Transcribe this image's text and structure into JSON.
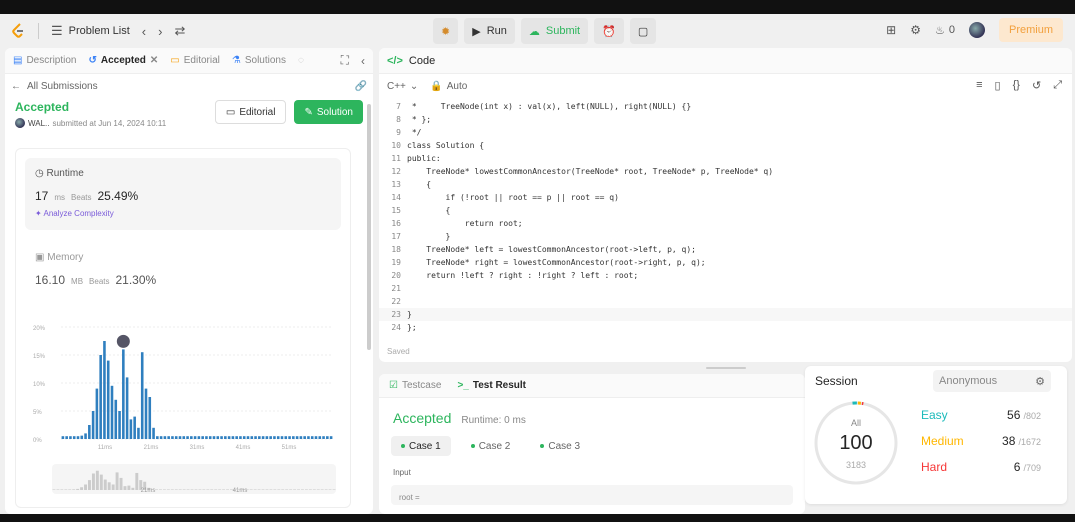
{
  "nav": {
    "problem_list": "Problem List",
    "run": "Run",
    "submit": "Submit",
    "streak": "0",
    "premium": "Premium"
  },
  "left_panel": {
    "tabs": [
      {
        "label": "Description"
      },
      {
        "label": "Accepted"
      },
      {
        "label": "Editorial"
      },
      {
        "label": "Solutions"
      }
    ],
    "back_label": "All Submissions",
    "status": "Accepted",
    "user": "WAL..",
    "submitted": "submitted at Jun 14, 2024 10:11",
    "editorial_btn": "Editorial",
    "solution_btn": "Solution",
    "runtime_label": "Runtime",
    "runtime_value": "17",
    "runtime_unit": "ms",
    "beats_label": "Beats",
    "runtime_beats": "25.49%",
    "analyze": "Analyze Complexity",
    "memory_label": "Memory",
    "memory_value": "16.10",
    "memory_unit": "MB",
    "memory_beats": "21.30%"
  },
  "chart_data": {
    "type": "bar",
    "y_ticks": [
      "20%",
      "15%",
      "10%",
      "5%",
      "0%"
    ],
    "x_ticks": [
      "11ms",
      "21ms",
      "31ms",
      "41ms",
      "51ms"
    ],
    "mini_ticks": [
      "21ms",
      "41ms"
    ],
    "ylim": [
      0,
      20
    ],
    "values": [
      0.5,
      0.5,
      0.5,
      0.5,
      0.5,
      0.6,
      1.0,
      2.5,
      5.0,
      9.0,
      15.0,
      17.5,
      14.0,
      9.5,
      7.0,
      5.0,
      16.0,
      11.0,
      3.5,
      4.0,
      2.0,
      15.5,
      9.0,
      7.5,
      2.0,
      0.5,
      0.5,
      0.5,
      0.5,
      0.5,
      0.5,
      0.5,
      0.5,
      0.5,
      0.5,
      0.5,
      0.5,
      0.5,
      0.5,
      0.5,
      0.5,
      0.5,
      0.5,
      0.5,
      0.5,
      0.5,
      0.5,
      0.5,
      0.5,
      0.5,
      0.5,
      0.5,
      0.5,
      0.5,
      0.5,
      0.5,
      0.5,
      0.5,
      0.5,
      0.5,
      0.5,
      0.5,
      0.5,
      0.5,
      0.5,
      0.5,
      0.5,
      0.5,
      0.5,
      0.5,
      0.5,
      0.5
    ],
    "highlight_index": 16,
    "color": "#2f7fbf"
  },
  "code_panel": {
    "title": "Code",
    "language": "C++",
    "mode": "Auto",
    "saved": "Saved",
    "lines": [
      {
        "n": "7",
        "text": " *     TreeNode(int x) : val(x), left(NULL), right(NULL) {}"
      },
      {
        "n": "8",
        "text": " * };"
      },
      {
        "n": "9",
        "text": " */"
      },
      {
        "n": "10",
        "text": "class Solution {"
      },
      {
        "n": "11",
        "text": "public:"
      },
      {
        "n": "12",
        "text": "    TreeNode* lowestCommonAncestor(TreeNode* root, TreeNode* p, TreeNode* q)"
      },
      {
        "n": "13",
        "text": "    {"
      },
      {
        "n": "14",
        "text": "        if (!root || root == p || root == q)"
      },
      {
        "n": "15",
        "text": "        {"
      },
      {
        "n": "16",
        "text": "            return root;"
      },
      {
        "n": "17",
        "text": "        }"
      },
      {
        "n": "18",
        "text": "    TreeNode* left = lowestCommonAncestor(root->left, p, q);"
      },
      {
        "n": "19",
        "text": "    TreeNode* right = lowestCommonAncestor(root->right, p, q);"
      },
      {
        "n": "20",
        "text": "    return !left ? right : !right ? left : root;"
      },
      {
        "n": "21",
        "text": ""
      },
      {
        "n": "22",
        "text": ""
      },
      {
        "n": "23",
        "text": "}"
      },
      {
        "n": "24",
        "text": "};"
      }
    ]
  },
  "bottom_panel": {
    "tab_testcase": "Testcase",
    "tab_result": "Test Result",
    "status": "Accepted",
    "runtime": "Runtime: 0 ms",
    "cases": [
      "Case 1",
      "Case 2",
      "Case 3"
    ],
    "input_label": "Input",
    "input_value": "root ="
  },
  "session": {
    "title": "Session",
    "selector": "Anonymous",
    "all_label": "All",
    "solved": "100",
    "total": "3183",
    "easy": {
      "name": "Easy",
      "solved": "56",
      "total": "/802",
      "color": "#1cbaba"
    },
    "medium": {
      "name": "Medium",
      "solved": "38",
      "total": "/1672",
      "color": "#ffb700"
    },
    "hard": {
      "name": "Hard",
      "solved": "6",
      "total": "/709",
      "color": "#f63737"
    }
  }
}
